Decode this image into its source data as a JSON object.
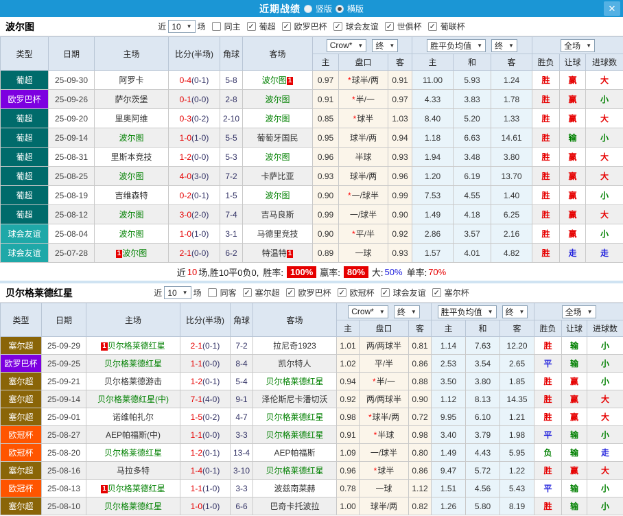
{
  "titlebar": {
    "title": "近期战绩",
    "radios": [
      {
        "label": "竖版",
        "selected": false
      },
      {
        "label": "横版",
        "selected": true
      }
    ],
    "close_label": "✕"
  },
  "table_header": {
    "cols": [
      "类型",
      "日期",
      "主场",
      "比分(半场)",
      "角球",
      "客场"
    ],
    "group_selects": [
      [
        "Crow*",
        "终"
      ],
      [
        "胜平负均值",
        "终"
      ],
      [
        "全场"
      ]
    ],
    "sub": [
      "主",
      "盘口",
      "客",
      "主",
      "和",
      "客",
      "胜负",
      "让球",
      "进球数"
    ],
    "select_arrow": "▼"
  },
  "type_colors": {
    "葡超": "#006b6b",
    "欧罗巴杯": "#7d00e0",
    "球会友谊": "#1fa8a8",
    "塞尔超": "#8a6508",
    "欧冠杯": "#ff5500"
  },
  "result_colors": {
    "胜": "#e60000",
    "平": "#2222dd",
    "负": "#008000",
    "赢": "#e60000",
    "输": "#008000",
    "走": "#2222dd",
    "大": "#e60000",
    "小": "#008000"
  },
  "sections": [
    {
      "team": "波尔图",
      "filter": {
        "prefix": "近",
        "count": "10",
        "suffix": "场",
        "same": {
          "label": "同主",
          "checked": false
        },
        "leagues": [
          {
            "label": "葡超",
            "checked": true
          },
          {
            "label": "欧罗巴杯",
            "checked": true
          },
          {
            "label": "球会友谊",
            "checked": true
          },
          {
            "label": "世俱杯",
            "checked": true
          },
          {
            "label": "葡联杯",
            "checked": true
          }
        ]
      },
      "rows": [
        {
          "type": "葡超",
          "date": "25-09-30",
          "home": "阿罗卡",
          "home_green": false,
          "home_badge": "",
          "ft": "0-4",
          "ht": "(0-1)",
          "corner": "5-8",
          "away": "波尔图",
          "away_green": true,
          "away_badge": "1",
          "o1": "0.97",
          "star": true,
          "pan": "球半/两",
          "o2": "0.91",
          "m1": "11.00",
          "m2": "5.93",
          "m3": "1.24",
          "r1": "胜",
          "r2": "赢",
          "r3": "大"
        },
        {
          "type": "欧罗巴杯",
          "date": "25-09-26",
          "home": "萨尔茨堡",
          "home_green": false,
          "home_badge": "",
          "ft": "0-1",
          "ht": "(0-0)",
          "corner": "2-8",
          "away": "波尔图",
          "away_green": true,
          "away_badge": "",
          "o1": "0.91",
          "star": true,
          "pan": "半/一",
          "o2": "0.97",
          "m1": "4.33",
          "m2": "3.83",
          "m3": "1.78",
          "r1": "胜",
          "r2": "赢",
          "r3": "小"
        },
        {
          "type": "葡超",
          "date": "25-09-20",
          "home": "里奥阿维",
          "home_green": false,
          "home_badge": "",
          "ft": "0-3",
          "ht": "(0-2)",
          "corner": "2-10",
          "away": "波尔图",
          "away_green": true,
          "away_badge": "",
          "o1": "0.85",
          "star": true,
          "pan": "球半",
          "o2": "1.03",
          "m1": "8.40",
          "m2": "5.20",
          "m3": "1.33",
          "r1": "胜",
          "r2": "赢",
          "r3": "大"
        },
        {
          "type": "葡超",
          "date": "25-09-14",
          "home": "波尔图",
          "home_green": true,
          "home_badge": "",
          "ft": "1-0",
          "ht": "(1-0)",
          "corner": "5-5",
          "away": "葡萄牙国民",
          "away_green": false,
          "away_badge": "",
          "o1": "0.95",
          "star": false,
          "pan": "球半/两",
          "o2": "0.94",
          "m1": "1.18",
          "m2": "6.63",
          "m3": "14.61",
          "r1": "胜",
          "r2": "输",
          "r3": "小"
        },
        {
          "type": "葡超",
          "date": "25-08-31",
          "home": "里斯本竞技",
          "home_green": false,
          "home_badge": "",
          "ft": "1-2",
          "ht": "(0-0)",
          "corner": "5-3",
          "away": "波尔图",
          "away_green": true,
          "away_badge": "",
          "o1": "0.96",
          "star": false,
          "pan": "半球",
          "o2": "0.93",
          "m1": "1.94",
          "m2": "3.48",
          "m3": "3.80",
          "r1": "胜",
          "r2": "赢",
          "r3": "大"
        },
        {
          "type": "葡超",
          "date": "25-08-25",
          "home": "波尔图",
          "home_green": true,
          "home_badge": "",
          "ft": "4-0",
          "ht": "(3-0)",
          "corner": "7-2",
          "away": "卡萨比亚",
          "away_green": false,
          "away_badge": "",
          "o1": "0.93",
          "star": false,
          "pan": "球半/两",
          "o2": "0.96",
          "m1": "1.20",
          "m2": "6.19",
          "m3": "13.70",
          "r1": "胜",
          "r2": "赢",
          "r3": "大"
        },
        {
          "type": "葡超",
          "date": "25-08-19",
          "home": "吉维森特",
          "home_green": false,
          "home_badge": "",
          "ft": "0-2",
          "ht": "(0-1)",
          "corner": "1-5",
          "away": "波尔图",
          "away_green": true,
          "away_badge": "",
          "o1": "0.90",
          "star": true,
          "pan": "一/球半",
          "o2": "0.99",
          "m1": "7.53",
          "m2": "4.55",
          "m3": "1.40",
          "r1": "胜",
          "r2": "赢",
          "r3": "小"
        },
        {
          "type": "葡超",
          "date": "25-08-12",
          "home": "波尔图",
          "home_green": true,
          "home_badge": "",
          "ft": "3-0",
          "ht": "(2-0)",
          "corner": "7-4",
          "away": "吉马良斯",
          "away_green": false,
          "away_badge": "",
          "o1": "0.99",
          "star": false,
          "pan": "一/球半",
          "o2": "0.90",
          "m1": "1.49",
          "m2": "4.18",
          "m3": "6.25",
          "r1": "胜",
          "r2": "赢",
          "r3": "大"
        },
        {
          "type": "球会友谊",
          "date": "25-08-04",
          "home": "波尔图",
          "home_green": true,
          "home_badge": "",
          "ft": "1-0",
          "ht": "(1-0)",
          "corner": "3-1",
          "away": "马德里竞技",
          "away_green": false,
          "away_badge": "",
          "o1": "0.90",
          "star": true,
          "pan": "平/半",
          "o2": "0.92",
          "m1": "2.86",
          "m2": "3.57",
          "m3": "2.16",
          "r1": "胜",
          "r2": "赢",
          "r3": "小"
        },
        {
          "type": "球会友谊",
          "date": "25-07-28",
          "home": "波尔图",
          "home_green": true,
          "home_badge": "1",
          "ft": "2-1",
          "ht": "(0-0)",
          "corner": "6-2",
          "away": "特温特",
          "away_green": false,
          "away_badge": "1",
          "o1": "0.89",
          "star": false,
          "pan": "一球",
          "o2": "0.93",
          "m1": "1.57",
          "m2": "4.01",
          "m3": "4.82",
          "r1": "胜",
          "r2": "走",
          "r3": "走"
        }
      ],
      "summary": {
        "prefix": "近",
        "count": "10",
        "record": "场,胜10平0负0,",
        "win_rate_label": "胜率:",
        "win_rate": "100%",
        "profit_label": "赢率:",
        "profit": "80%",
        "big_label": "大:",
        "big": "50%",
        "single_label": "单率:",
        "single": "70%"
      }
    },
    {
      "team": "贝尔格莱德红星",
      "filter": {
        "prefix": "近",
        "count": "10",
        "suffix": "场",
        "same": {
          "label": "同客",
          "checked": false
        },
        "leagues": [
          {
            "label": "塞尔超",
            "checked": true
          },
          {
            "label": "欧罗巴杯",
            "checked": true
          },
          {
            "label": "欧冠杯",
            "checked": true
          },
          {
            "label": "球会友谊",
            "checked": true
          },
          {
            "label": "塞尔杯",
            "checked": true
          }
        ]
      },
      "rows": [
        {
          "type": "塞尔超",
          "date": "25-09-29",
          "home": "贝尔格莱德红星",
          "home_green": true,
          "home_badge": "1",
          "ft": "2-1",
          "ht": "(0-1)",
          "corner": "7-2",
          "away": "拉尼奇1923",
          "away_green": false,
          "away_badge": "",
          "o1": "1.01",
          "star": false,
          "pan": "两/两球半",
          "o2": "0.81",
          "m1": "1.14",
          "m2": "7.63",
          "m3": "12.20",
          "r1": "胜",
          "r2": "输",
          "r3": "小"
        },
        {
          "type": "欧罗巴杯",
          "date": "25-09-25",
          "home": "贝尔格莱德红星",
          "home_green": true,
          "home_badge": "",
          "ft": "1-1",
          "ht": "(0-0)",
          "corner": "8-4",
          "away": "凯尔特人",
          "away_green": false,
          "away_badge": "",
          "o1": "1.02",
          "star": false,
          "pan": "平/半",
          "o2": "0.86",
          "m1": "2.53",
          "m2": "3.54",
          "m3": "2.65",
          "r1": "平",
          "r2": "输",
          "r3": "小"
        },
        {
          "type": "塞尔超",
          "date": "25-09-21",
          "home": "贝尔格莱德游击",
          "home_green": false,
          "home_badge": "",
          "ft": "1-2",
          "ht": "(0-1)",
          "corner": "5-4",
          "away": "贝尔格莱德红星",
          "away_green": true,
          "away_badge": "",
          "o1": "0.94",
          "star": true,
          "pan": "半/一",
          "o2": "0.88",
          "m1": "3.50",
          "m2": "3.80",
          "m3": "1.85",
          "r1": "胜",
          "r2": "赢",
          "r3": "小"
        },
        {
          "type": "塞尔超",
          "date": "25-09-14",
          "home": "贝尔格莱德红星(中)",
          "home_green": true,
          "home_badge": "",
          "ft": "7-1",
          "ht": "(4-0)",
          "corner": "9-1",
          "away": "泽伦斯尼卡潘切沃",
          "away_green": false,
          "away_badge": "",
          "o1": "0.92",
          "star": false,
          "pan": "两/两球半",
          "o2": "0.90",
          "m1": "1.12",
          "m2": "8.13",
          "m3": "14.35",
          "r1": "胜",
          "r2": "赢",
          "r3": "大"
        },
        {
          "type": "塞尔超",
          "date": "25-09-01",
          "home": "诺维帕扎尔",
          "home_green": false,
          "home_badge": "",
          "ft": "1-5",
          "ht": "(0-2)",
          "corner": "4-7",
          "away": "贝尔格莱德红星",
          "away_green": true,
          "away_badge": "",
          "o1": "0.98",
          "star": true,
          "pan": "球半/两",
          "o2": "0.72",
          "m1": "9.95",
          "m2": "6.10",
          "m3": "1.21",
          "r1": "胜",
          "r2": "赢",
          "r3": "大"
        },
        {
          "type": "欧冠杯",
          "date": "25-08-27",
          "home": "AEP帕福斯(中)",
          "home_green": false,
          "home_badge": "",
          "ft": "1-1",
          "ht": "(0-0)",
          "corner": "3-3",
          "away": "贝尔格莱德红星",
          "away_green": true,
          "away_badge": "",
          "o1": "0.91",
          "star": true,
          "pan": "半球",
          "o2": "0.98",
          "m1": "3.40",
          "m2": "3.79",
          "m3": "1.98",
          "r1": "平",
          "r2": "输",
          "r3": "小"
        },
        {
          "type": "欧冠杯",
          "date": "25-08-20",
          "home": "贝尔格莱德红星",
          "home_green": true,
          "home_badge": "",
          "ft": "1-2",
          "ht": "(0-1)",
          "corner": "13-4",
          "away": "AEP帕福斯",
          "away_green": false,
          "away_badge": "",
          "o1": "1.09",
          "star": false,
          "pan": "一/球半",
          "o2": "0.80",
          "m1": "1.49",
          "m2": "4.43",
          "m3": "5.95",
          "r1": "负",
          "r2": "输",
          "r3": "走"
        },
        {
          "type": "塞尔超",
          "date": "25-08-16",
          "home": "马拉多特",
          "home_green": false,
          "home_badge": "",
          "ft": "1-4",
          "ht": "(0-1)",
          "corner": "3-10",
          "away": "贝尔格莱德红星",
          "away_green": true,
          "away_badge": "",
          "o1": "0.96",
          "star": true,
          "pan": "球半",
          "o2": "0.86",
          "m1": "9.47",
          "m2": "5.72",
          "m3": "1.22",
          "r1": "胜",
          "r2": "赢",
          "r3": "大"
        },
        {
          "type": "欧冠杯",
          "date": "25-08-13",
          "home": "贝尔格莱德红星",
          "home_green": true,
          "home_badge": "1",
          "ft": "1-1",
          "ht": "(1-0)",
          "corner": "3-3",
          "away": "波兹南莱赫",
          "away_green": false,
          "away_badge": "",
          "o1": "0.78",
          "star": false,
          "pan": "一球",
          "o2": "1.12",
          "m1": "1.51",
          "m2": "4.56",
          "m3": "5.43",
          "r1": "平",
          "r2": "输",
          "r3": "小"
        },
        {
          "type": "塞尔超",
          "date": "25-08-10",
          "home": "贝尔格莱德红星",
          "home_green": true,
          "home_badge": "",
          "ft": "1-0",
          "ht": "(1-0)",
          "corner": "6-6",
          "away": "巴奇卡托波拉",
          "away_green": false,
          "away_badge": "",
          "o1": "1.00",
          "star": false,
          "pan": "球半/两",
          "o2": "0.82",
          "m1": "1.26",
          "m2": "5.80",
          "m3": "8.19",
          "r1": "胜",
          "r2": "输",
          "r3": "小"
        }
      ],
      "summary": null
    }
  ]
}
